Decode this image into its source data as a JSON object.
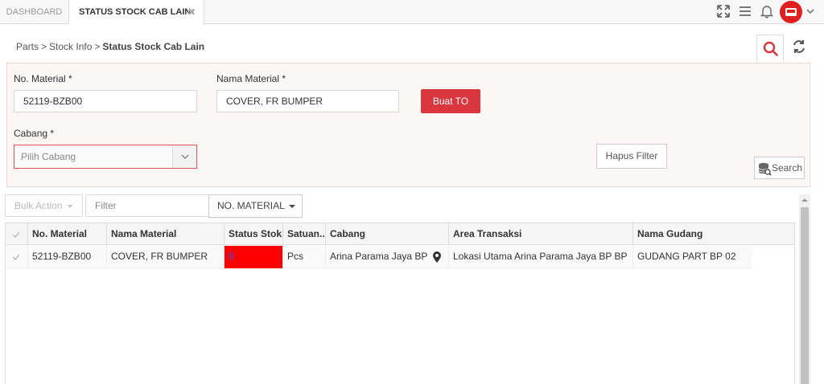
{
  "tabs": {
    "dashboard": "DASHBOARD",
    "active": "STATUS STOCK CAB LAIN",
    "close": "✖"
  },
  "breadcrumb": {
    "items": [
      "Parts",
      "Stock Info",
      "Status Stock Cab Lain"
    ],
    "separator": ">"
  },
  "form": {
    "no_material_label": "No. Material *",
    "no_material_value": "52119-BZB00",
    "nama_material_label": "Nama Material *",
    "nama_material_value": "COVER, FR BUMPER",
    "cabang_label": "Cabang *",
    "cabang_placeholder": "Pilih Cabang",
    "buat_to_label": "Buat TO",
    "hapus_filter_label": "Hapus Filter",
    "search_label": "Search"
  },
  "toolbar": {
    "bulk_action_label": "Bulk Action",
    "filter_placeholder": "Filter",
    "filter_column_label": "NO. MATERIAL"
  },
  "table": {
    "headers": [
      "No. Material",
      "Nama Material",
      "Status Stok...",
      "Satuan...",
      "Cabang",
      "Area Transaksi",
      "Nama Gudang"
    ],
    "rows": [
      {
        "no_material": "52119-BZB00",
        "nama_material": "COVER, FR BUMPER",
        "status_stok": "0",
        "satuan": "Pcs",
        "cabang": "Arina Parama Jaya BP",
        "area_transaksi": "Lokasi Utama Arina Parama Jaya BP BP",
        "nama_gudang": "GUDANG PART BP 02"
      }
    ]
  },
  "colors": {
    "accent_red": "#d9363e",
    "status_cell": "#ff0000"
  },
  "icons": [
    "expand-icon",
    "menu-icon",
    "bell-icon",
    "avatar-car-icon",
    "search-icon",
    "refresh-icon",
    "map-pin-icon",
    "database-icon",
    "check-icon"
  ]
}
